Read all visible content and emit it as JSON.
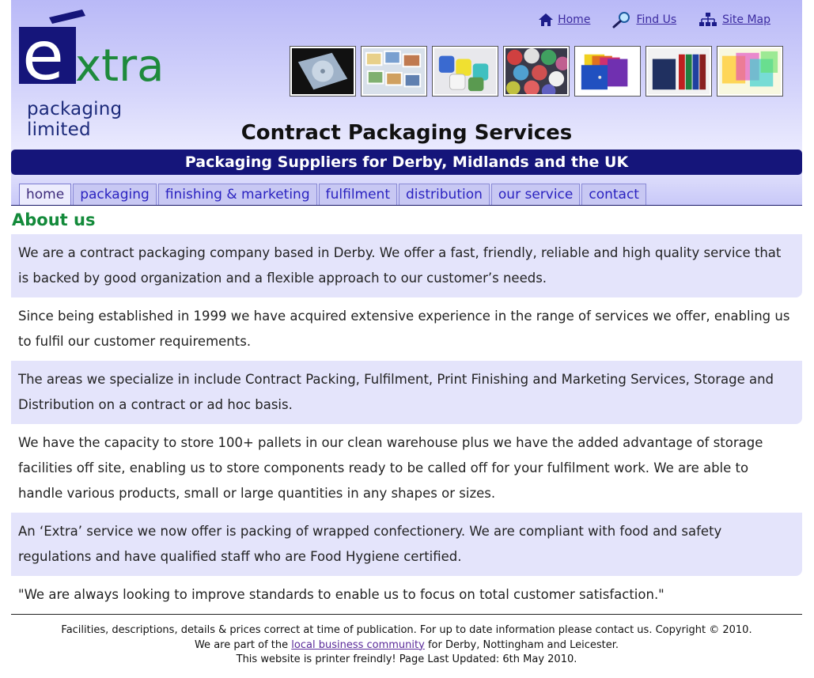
{
  "header": {
    "logo_word": "xtra",
    "logo_letter": "e",
    "logo_tagline": "packaging limited",
    "title": "Contract Packaging Services",
    "subtitle": "Packaging Suppliers for Derby, Midlands and the UK"
  },
  "toplinks": [
    {
      "label": "Home",
      "icon": "home-icon"
    },
    {
      "label": "Find Us",
      "icon": "magnifier-icon"
    },
    {
      "label": "Site Map",
      "icon": "sitemap-icon"
    }
  ],
  "thumbnails": [
    {
      "name": "cd-case-thumbnail"
    },
    {
      "name": "photo-cards-thumbnail"
    },
    {
      "name": "label-rolls-thumbnail"
    },
    {
      "name": "chocolate-balls-thumbnail"
    },
    {
      "name": "folders-thumbnail"
    },
    {
      "name": "binders-thumbnail"
    },
    {
      "name": "plastic-cases-thumbnail"
    }
  ],
  "tabs": [
    {
      "label": "home",
      "active": true
    },
    {
      "label": "packaging"
    },
    {
      "label": "finishing & marketing"
    },
    {
      "label": "fulfilment"
    },
    {
      "label": "distribution"
    },
    {
      "label": "our service"
    },
    {
      "label": "contact"
    }
  ],
  "content": {
    "heading": "About us",
    "paragraphs": [
      "We are a contract packaging company based in Derby. We offer a fast, friendly, reliable and high quality service that is backed by good organization and a flexible approach to our customer’s needs.",
      "Since being established in 1999 we have acquired extensive experience in the range of services we offer, enabling us to fulfil our customer requirements.",
      "The areas we specialize in include Contract Packing, Fulfilment, Print Finishing and Marketing Services, Storage and Distribution on a contract or ad hoc basis.",
      "We have the capacity to store 100+ pallets in our clean warehouse plus we have the added advantage of storage facilities off site, enabling us to store components ready to be called off for your fulfilment work. We are able to handle various products, small or large quantities in any shapes or sizes.",
      "An ‘Extra’ service we now offer is packing of wrapped confectionery. We are compliant with food and safety regulations and have qualified staff who are Food Hygiene certified.",
      "\"We are always looking to improve standards to enable us to focus on total customer satisfaction.\""
    ]
  },
  "footer": {
    "line1": "Facilities, descriptions, details & prices correct at time of publication. For up to date information please contact us. Copyright © 2010.",
    "line2_before": "We are part of the ",
    "line2_link": "local business community",
    "line2_after": " for Derby, Nottingham and Leicester.",
    "line3": "This website is printer freindly! Page Last Updated: 6th May 2010."
  },
  "colors": {
    "brand_navy": "#15157a",
    "heading_green": "#138a3a",
    "logo_green": "#1e8a3c",
    "shaded_row": "#e4e4fb",
    "tab_bg": "#c8c8f3"
  }
}
